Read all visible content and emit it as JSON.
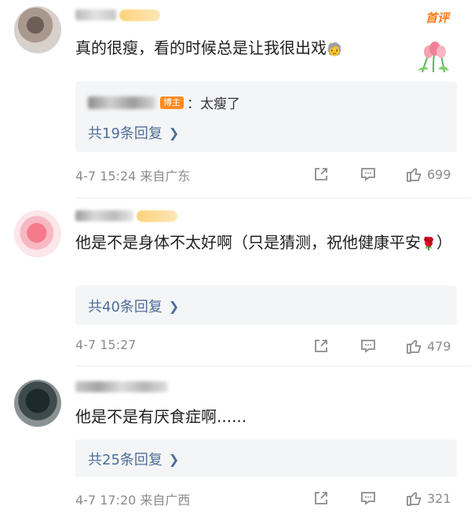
{
  "comments": [
    {
      "top_tag": "首评",
      "text": "真的很瘦，看的时候总是让我很出戏",
      "emoji": "🧓",
      "reply": {
        "author_badge": "博主",
        "text": "：太瘦了",
        "more": "共19条回复"
      },
      "time": "4-7 15:24 来自广东",
      "likes": "699"
    },
    {
      "text": "他是不是身体不太好啊（只是猜测，祝他健康平安",
      "emoji": "🌹",
      "text_end": "）",
      "reply_more": "共40条回复",
      "time": "4-7 15:27",
      "likes": "479"
    },
    {
      "text": "他是不是有厌食症啊......",
      "reply_more": "共25条回复",
      "time": "4-7 17:20 来自广西",
      "likes": "321"
    }
  ],
  "icons": {
    "share": "share-icon",
    "comment": "comment-icon",
    "like": "thumbs-up-icon",
    "more": "chevron-right-icon"
  },
  "colors": {
    "link": "#4e6e9b",
    "accent": "#ff7a1a",
    "meta": "#8b8b8b",
    "reply_bg": "#f4f5f7"
  }
}
